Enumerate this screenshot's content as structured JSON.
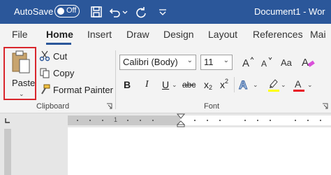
{
  "titlebar": {
    "autosave_label": "AutoSave",
    "toggle_state": "Off",
    "document_title": "Document1 - Wor",
    "bg_color": "#2b579a"
  },
  "tabs": [
    {
      "label": "File",
      "active": false
    },
    {
      "label": "Home",
      "active": true
    },
    {
      "label": "Insert",
      "active": false
    },
    {
      "label": "Draw",
      "active": false
    },
    {
      "label": "Design",
      "active": false
    },
    {
      "label": "Layout",
      "active": false
    },
    {
      "label": "References",
      "active": false
    },
    {
      "label": "Mai",
      "active": false
    }
  ],
  "clipboard": {
    "paste_label": "Paste",
    "cut_label": "Cut",
    "copy_label": "Copy",
    "format_painter_label": "Format Painter",
    "group_label": "Clipboard"
  },
  "font": {
    "font_name": "Calibri (Body)",
    "font_size": "11",
    "group_label": "Font",
    "bold": "B",
    "italic": "I",
    "underline": "U",
    "strikethrough": "abc",
    "subscript": "x",
    "superscript": "x",
    "sub_digit": "2",
    "super_digit": "2",
    "font_color": "#e81123",
    "highlight_color": "#ffff00"
  },
  "ruler": {
    "numbers": [
      "1"
    ]
  }
}
